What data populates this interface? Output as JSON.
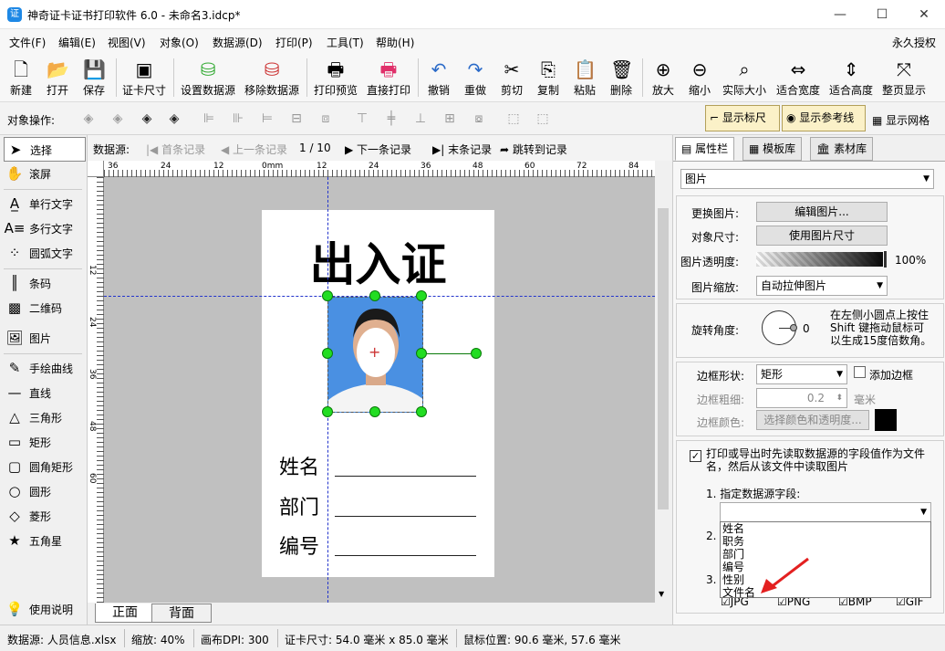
{
  "window": {
    "title": "神奇证卡证书打印软件 6.0 - 未命名3.idcp*",
    "minimize": "—",
    "maximize": "☐",
    "close": "✕"
  },
  "menu": [
    "文件(F)",
    "编辑(E)",
    "视图(V)",
    "对象(O)",
    "数据源(D)",
    "打印(P)",
    "工具(T)",
    "帮助(H)"
  ],
  "license": "永久授权",
  "toolbar": [
    {
      "label": "新建",
      "icon": "new-file-icon"
    },
    {
      "label": "打开",
      "icon": "open-icon"
    },
    {
      "label": "保存",
      "icon": "save-icon"
    },
    {
      "label": "证卡尺寸",
      "icon": "card-size-icon"
    },
    {
      "label": "设置数据源",
      "icon": "database-icon"
    },
    {
      "label": "移除数据源",
      "icon": "remove-database-icon"
    },
    {
      "label": "打印预览",
      "icon": "print-preview-icon"
    },
    {
      "label": "直接打印",
      "icon": "printer-icon"
    },
    {
      "label": "撤销",
      "icon": "undo-icon"
    },
    {
      "label": "重做",
      "icon": "redo-icon"
    },
    {
      "label": "剪切",
      "icon": "cut-icon"
    },
    {
      "label": "复制",
      "icon": "copy-icon"
    },
    {
      "label": "粘贴",
      "icon": "paste-icon"
    },
    {
      "label": "删除",
      "icon": "delete-icon"
    },
    {
      "label": "放大",
      "icon": "zoom-in-icon"
    },
    {
      "label": "缩小",
      "icon": "zoom-out-icon"
    },
    {
      "label": "实际大小",
      "icon": "actual-size-icon"
    },
    {
      "label": "适合宽度",
      "icon": "fit-width-icon"
    },
    {
      "label": "适合高度",
      "icon": "fit-height-icon"
    },
    {
      "label": "整页显示",
      "icon": "full-page-icon"
    }
  ],
  "objbar": {
    "label": "对象操作:",
    "show_ruler": "显示标尺",
    "show_guides": "显示参考线",
    "show_grid": "显示网格"
  },
  "tools": [
    "选择",
    "滚屏",
    "单行文字",
    "多行文字",
    "圆弧文字",
    "条码",
    "二维码",
    "图片",
    "手绘曲线",
    "直线",
    "三角形",
    "矩形",
    "圆角矩形",
    "圆形",
    "菱形",
    "五角星"
  ],
  "help": "使用说明",
  "nav": {
    "label": "数据源:",
    "first": "首条记录",
    "prev": "上一条记录",
    "pos": "1 / 10",
    "next": "下一条记录",
    "last": "末条记录",
    "jump": "跳转到记录"
  },
  "ruler_top": [
    "36",
    "24",
    "12",
    "0mm",
    "12",
    "24",
    "36",
    "48",
    "60",
    "72",
    "84"
  ],
  "ruler_left": [
    "12",
    "24",
    "36",
    "48",
    "60"
  ],
  "card": {
    "title": "出入证",
    "fields": [
      "姓名",
      "部门",
      "编号"
    ]
  },
  "tabs": [
    "正面",
    "背面"
  ],
  "panel": {
    "tabs": [
      "属性栏",
      "模板库",
      "素材库"
    ],
    "object_type": "图片",
    "replace_label": "更换图片:",
    "replace_btn": "编辑图片...",
    "size_label": "对象尺寸:",
    "size_btn": "使用图片尺寸",
    "opacity_label": "图片透明度:",
    "opacity_value": "100%",
    "opacity_level": 1.0,
    "scale_label": "图片缩放:",
    "scale_value": "自动拉伸图片",
    "rotate_label": "旋转角度:",
    "rotate_value": "0",
    "rotate_hint": "在左侧小圆点上按住 Shift 键拖动鼠标可以生成15度倍数角。",
    "border_shape_label": "边框形状:",
    "border_shape_value": "矩形",
    "add_border": "添加边框",
    "border_width_label": "边框粗细:",
    "border_width_value": "0.2",
    "border_width_unit": "毫米",
    "border_color_label": "边框颜色:",
    "border_color_btn": "选择颜色和透明度...",
    "read_field_check": "打印或导出时先读取数据源的字段值作为文件名，然后从该文件中读取图片",
    "step1": "1. 指定数据源字段:",
    "step2": "2.",
    "step3": "3.",
    "dropdown_options": [
      "姓名",
      "职务",
      "部门",
      "编号",
      "性别",
      "文件名"
    ],
    "formats": [
      "JPG",
      "PNG",
      "BMP",
      "GIF"
    ]
  },
  "status": {
    "source": "数据源: 人员信息.xlsx",
    "zoom": "缩放: 40%",
    "dpi": "画布DPI: 300",
    "card_size": "证卡尺寸: 54.0 毫米 x 85.0 毫米",
    "mouse": "鼠标位置: 90.6 毫米, 57.6 毫米"
  }
}
